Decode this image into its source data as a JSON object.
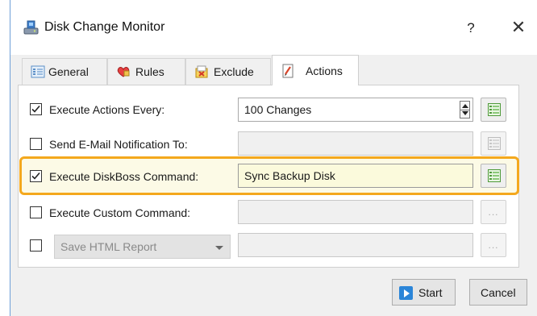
{
  "window": {
    "title": "Disk Change Monitor",
    "help_label": "?",
    "close_label": "✕"
  },
  "tabs": [
    {
      "label": "General",
      "icon": "general-icon",
      "active": false
    },
    {
      "label": "Rules",
      "icon": "rules-icon",
      "active": false
    },
    {
      "label": "Exclude",
      "icon": "exclude-icon",
      "active": false
    },
    {
      "label": "Actions",
      "icon": "actions-icon",
      "active": true
    }
  ],
  "actions": {
    "execute_every": {
      "label": "Execute Actions Every:",
      "checked": true,
      "value": "100 Changes"
    },
    "send_email": {
      "label": "Send E-Mail Notification To:",
      "checked": false,
      "value": ""
    },
    "diskboss_command": {
      "label": "Execute DiskBoss Command:",
      "checked": true,
      "value": "Sync Backup Disk"
    },
    "custom_command": {
      "label": "Execute Custom Command:",
      "checked": false,
      "value": "",
      "browse_label": "..."
    },
    "report": {
      "select_value": "Save HTML Report",
      "checked": false,
      "value": "",
      "browse_label": "..."
    }
  },
  "buttons": {
    "start": "Start",
    "cancel": "Cancel"
  },
  "colors": {
    "highlight": "#f4a81d",
    "accent": "#2b85d8"
  }
}
